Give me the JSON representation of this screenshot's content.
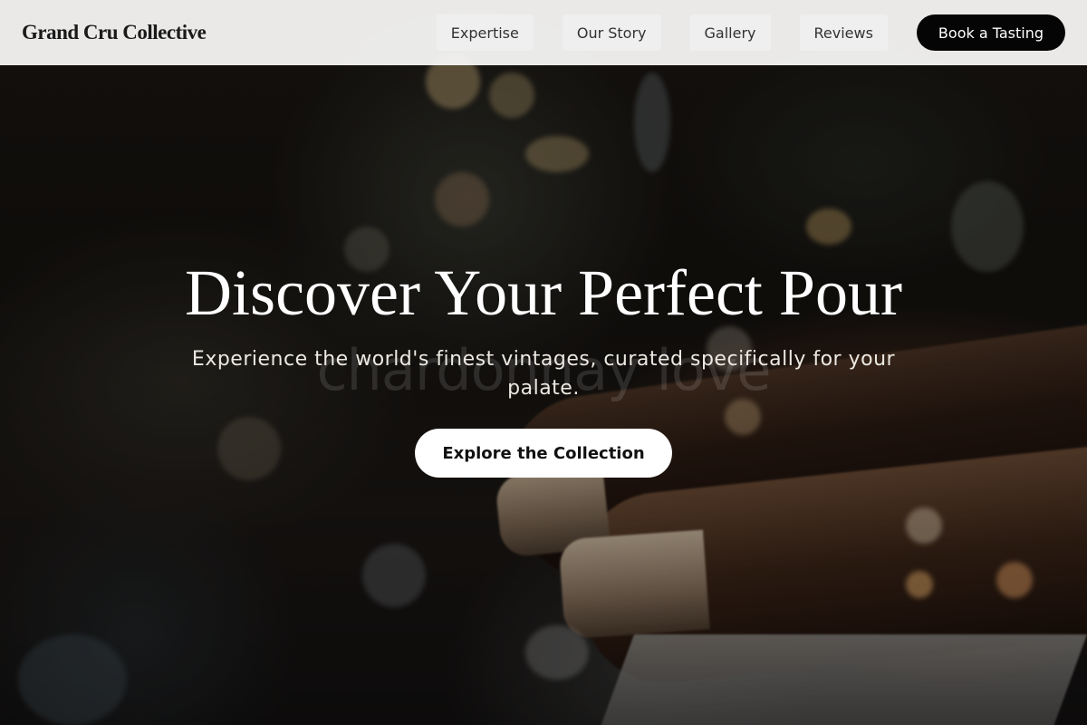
{
  "header": {
    "brand": "Grand Cru Collective",
    "nav": [
      {
        "label": "Expertise"
      },
      {
        "label": "Our Story"
      },
      {
        "label": "Gallery"
      },
      {
        "label": "Reviews"
      }
    ],
    "cta_label": "Book a Tasting"
  },
  "hero": {
    "title": "Discover Your Perfect Pour",
    "subtitle": "Experience the world's finest vintages, curated specifically for your palate.",
    "ghost_text": "chardonnay love",
    "button_label": "Explore the Collection",
    "background_image": "blurred wine bottles in a cellar rack"
  },
  "colors": {
    "header_bg": "#f8f8f6",
    "cta_bg": "#050505",
    "cta_text": "#ffffff",
    "hero_text": "#ffffff",
    "button_bg": "#ffffff"
  }
}
